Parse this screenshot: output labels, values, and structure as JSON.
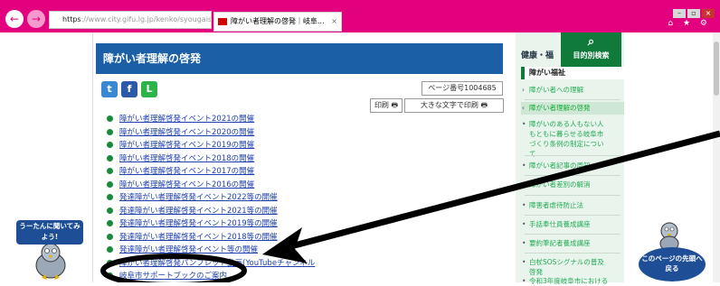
{
  "browser": {
    "url_scheme": "https",
    "url_rest": "://www.city.gifu.lg.jp/kenko/syougaisyh",
    "tab_title": "障がい者理解の啓発｜岐阜...",
    "tab_close": "×",
    "back_glyph": "←",
    "forward_glyph": "→",
    "window_buttons": [
      "–",
      "▫",
      "×"
    ],
    "toolbar_icons": "⌂ ★ ⚙"
  },
  "page": {
    "header_title": "障がい者理解の啓発",
    "page_number": "ページ番号1004685",
    "print_label": "印刷",
    "big_print_label": "大きな文字で印刷",
    "social": [
      "t",
      "f",
      "L"
    ],
    "links": [
      "障がい者理解啓発イベント2021の開催",
      "障がい者理解啓発イベント2020の開催",
      "障がい者理解啓発イベント2019の開催",
      "障がい者理解啓発イベント2018の開催",
      "障がい者理解啓発イベント2017の開催",
      "障がい者理解啓発イベント2016の開催",
      "発達障がい者理解啓発イベント2022等の開催",
      "発達障がい者理解啓発イベント2021等の開催",
      "発達障がい者理解啓発イベント2019等の開催",
      "発達障がい者理解啓発イベント2018等の開催",
      "発達障がい者理解啓発イベント等の開催",
      "障がい者理解啓発パンフレット動画(YouTubeチャンネル",
      "岐阜市サポートブックのご案内"
    ],
    "left_bubble": "うーたんに聞いてみよう!",
    "right_bubble": "このページの先頭へ戻る"
  },
  "sidebar": {
    "health_label": "健康・福",
    "search_icon": "⌕",
    "search_label": "目的別検索",
    "head": "障がい福祉",
    "items": [
      {
        "label": "障がい者への理解",
        "arrow": "›"
      },
      {
        "label": "障がい者理解の啓発",
        "arrow": "‹"
      },
      {
        "label": "障がいのある人もない人もともに暮らせる岐阜市づくり条例の制定について",
        "arrow": "•"
      },
      {
        "label": "障がい者記事の周知",
        "arrow": "•"
      },
      {
        "label": "障がい者差別の解消",
        "arrow": "•"
      },
      {
        "label": "障害者虐待防止法",
        "arrow": "•"
      },
      {
        "label": "手話奉仕員養成講座",
        "arrow": "•"
      },
      {
        "label": "要約筆記者養成講座",
        "arrow": "•"
      },
      {
        "label": "白杖SOSシグナルの普及啓発",
        "arrow": "•"
      },
      {
        "label": "令和3年度岐阜市における",
        "arrow": "•"
      }
    ]
  },
  "colors": {
    "browser_chrome": "#e3007f",
    "header_bg": "#1b5fa7",
    "link": "#2040b0",
    "bullet": "#1a8a3a",
    "sidebar_bg": "#e9f5ec",
    "search_bg": "#0f7a3a"
  }
}
